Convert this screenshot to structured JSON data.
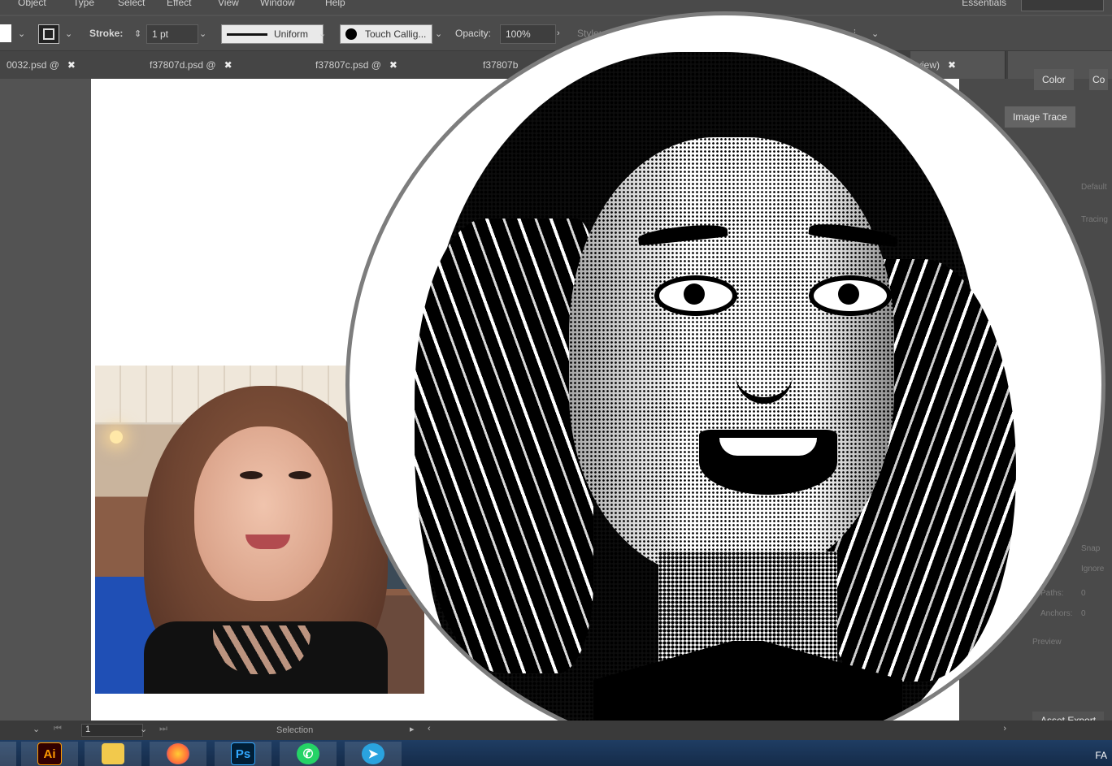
{
  "menubar": {
    "items": [
      "Object",
      "Type",
      "Select",
      "Effect",
      "View",
      "Window",
      "Help"
    ],
    "workspace": "Essentials"
  },
  "controlbar": {
    "stroke_label": "Stroke:",
    "stroke_weight": "1 pt",
    "profile": "Uniform",
    "brush": "Touch Callig...",
    "opacity_label": "Opacity:",
    "opacity_value": "100%",
    "style_label": "Style:"
  },
  "tabs": [
    {
      "label": "0032.psd @"
    },
    {
      "label": "f37807d.psd @"
    },
    {
      "label": "f37807c.psd @"
    },
    {
      "label": "f37807b"
    },
    {
      "label": "view)"
    }
  ],
  "right_panel": {
    "color_tab": "Color",
    "color_tab_partial": "Co",
    "image_trace_tab": "Image Trace",
    "preset_label": "Default",
    "view_label": "Tracing",
    "snap_label": "Snap",
    "ignore_label": "Ignore",
    "paths_label": "Paths:",
    "paths_value": "0",
    "anchors_label": "Anchors:",
    "anchors_value": "0",
    "preview_label": "Preview",
    "asset_export": "Asset Export"
  },
  "statusbar": {
    "zoom": "1",
    "mode": "Selection"
  },
  "taskbar": {
    "apps": [
      {
        "label": "Ai",
        "icon": "illustrator-icon",
        "color": "#ff9a00"
      },
      {
        "label": "",
        "icon": "folder-icon",
        "color": "#f2c94c"
      },
      {
        "label": "",
        "icon": "firefox-icon",
        "color": "#ff7139"
      },
      {
        "label": "Ps",
        "icon": "photoshop-icon",
        "color": "#31a8ff"
      },
      {
        "label": "",
        "icon": "whatsapp-icon",
        "color": "#25d366"
      },
      {
        "label": "",
        "icon": "telegram-icon",
        "color": "#2aa3df"
      }
    ],
    "language": "FA"
  },
  "colors": {
    "workspace_bg": "#535353",
    "artboard": "#ffffff",
    "taskbar": "#1f3d63"
  }
}
